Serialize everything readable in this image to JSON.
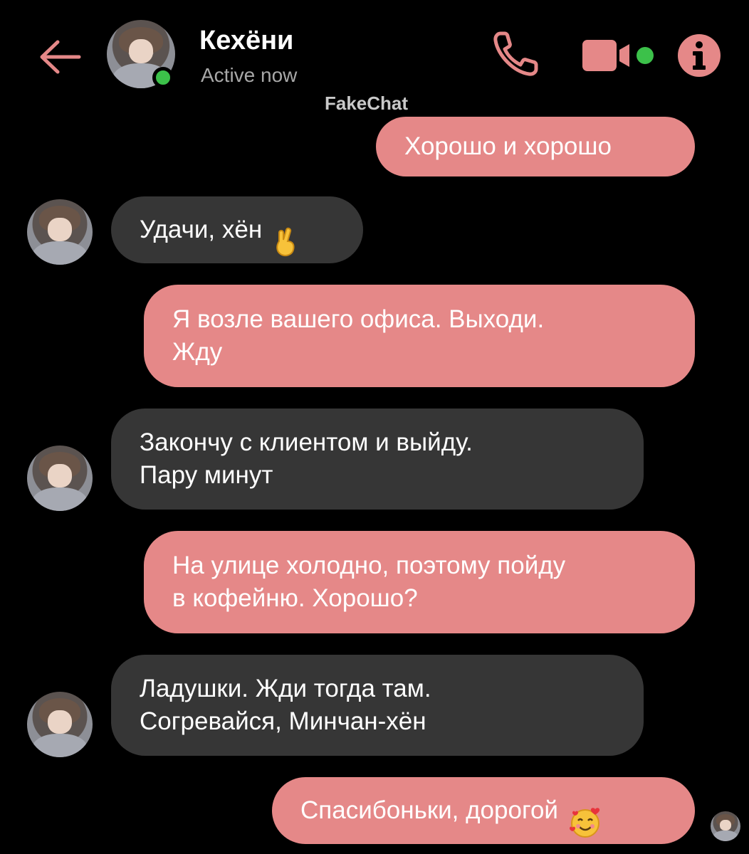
{
  "header": {
    "contact_name": "Кехёни",
    "status": "Active now",
    "watermark": "FakeChat"
  },
  "colors": {
    "accent": "#e58888",
    "incoming_bubble": "#363636",
    "online": "#3cc14a",
    "background": "#000000"
  },
  "icons": {
    "back": "back-arrow-icon",
    "call": "phone-icon",
    "video": "video-camera-icon",
    "info": "info-icon"
  },
  "messages": [
    {
      "direction": "out",
      "text": "Хорошо и хорошо"
    },
    {
      "direction": "in",
      "text": "Удачи, хён",
      "emoji": "🤞"
    },
    {
      "direction": "out",
      "text": "Я возле вашего офиса. Выходи.\nЖду"
    },
    {
      "direction": "in",
      "text": "Закончу с клиентом и выйду.\nПару минут"
    },
    {
      "direction": "out",
      "text": "На улице холодно, поэтому пойду\nв кофейню. Хорошо?"
    },
    {
      "direction": "in",
      "text": "Ладушки. Жди тогда там.\nСогревайся, Минчан-хён"
    },
    {
      "direction": "out",
      "text": "Спасибоньки, дорогой",
      "emoji": "🥰"
    }
  ]
}
